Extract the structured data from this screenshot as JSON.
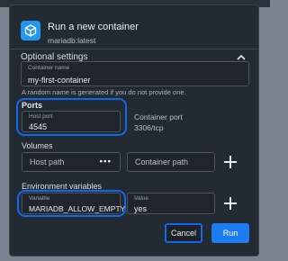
{
  "dialog": {
    "title": "Run a new container",
    "subtitle": "mariadb:latest",
    "optional_settings": "Optional settings"
  },
  "container_name": {
    "label": "Container name",
    "value": "my-first-container",
    "helper": "A random name is generated if you do not provide one."
  },
  "ports": {
    "heading": "Ports",
    "host_port_label": "Host port",
    "host_port_value": "4545",
    "container_port_label": "Container port",
    "container_port_value": "3306/tcp"
  },
  "volumes": {
    "heading": "Volumes",
    "host_path_placeholder": "Host path",
    "host_path_more": "•••",
    "container_path_placeholder": "Container path"
  },
  "env": {
    "heading": "Environment variables",
    "variable_label": "Variable",
    "variable_value": "MARIADB_ALLOW_EMPTY",
    "value_label": "Value",
    "value_value": "yes"
  },
  "actions": {
    "cancel": "Cancel",
    "run": "Run"
  },
  "colors": {
    "accent": "#1d7cf2",
    "highlight": "#1267f0",
    "dialog_bg": "#242a31"
  }
}
